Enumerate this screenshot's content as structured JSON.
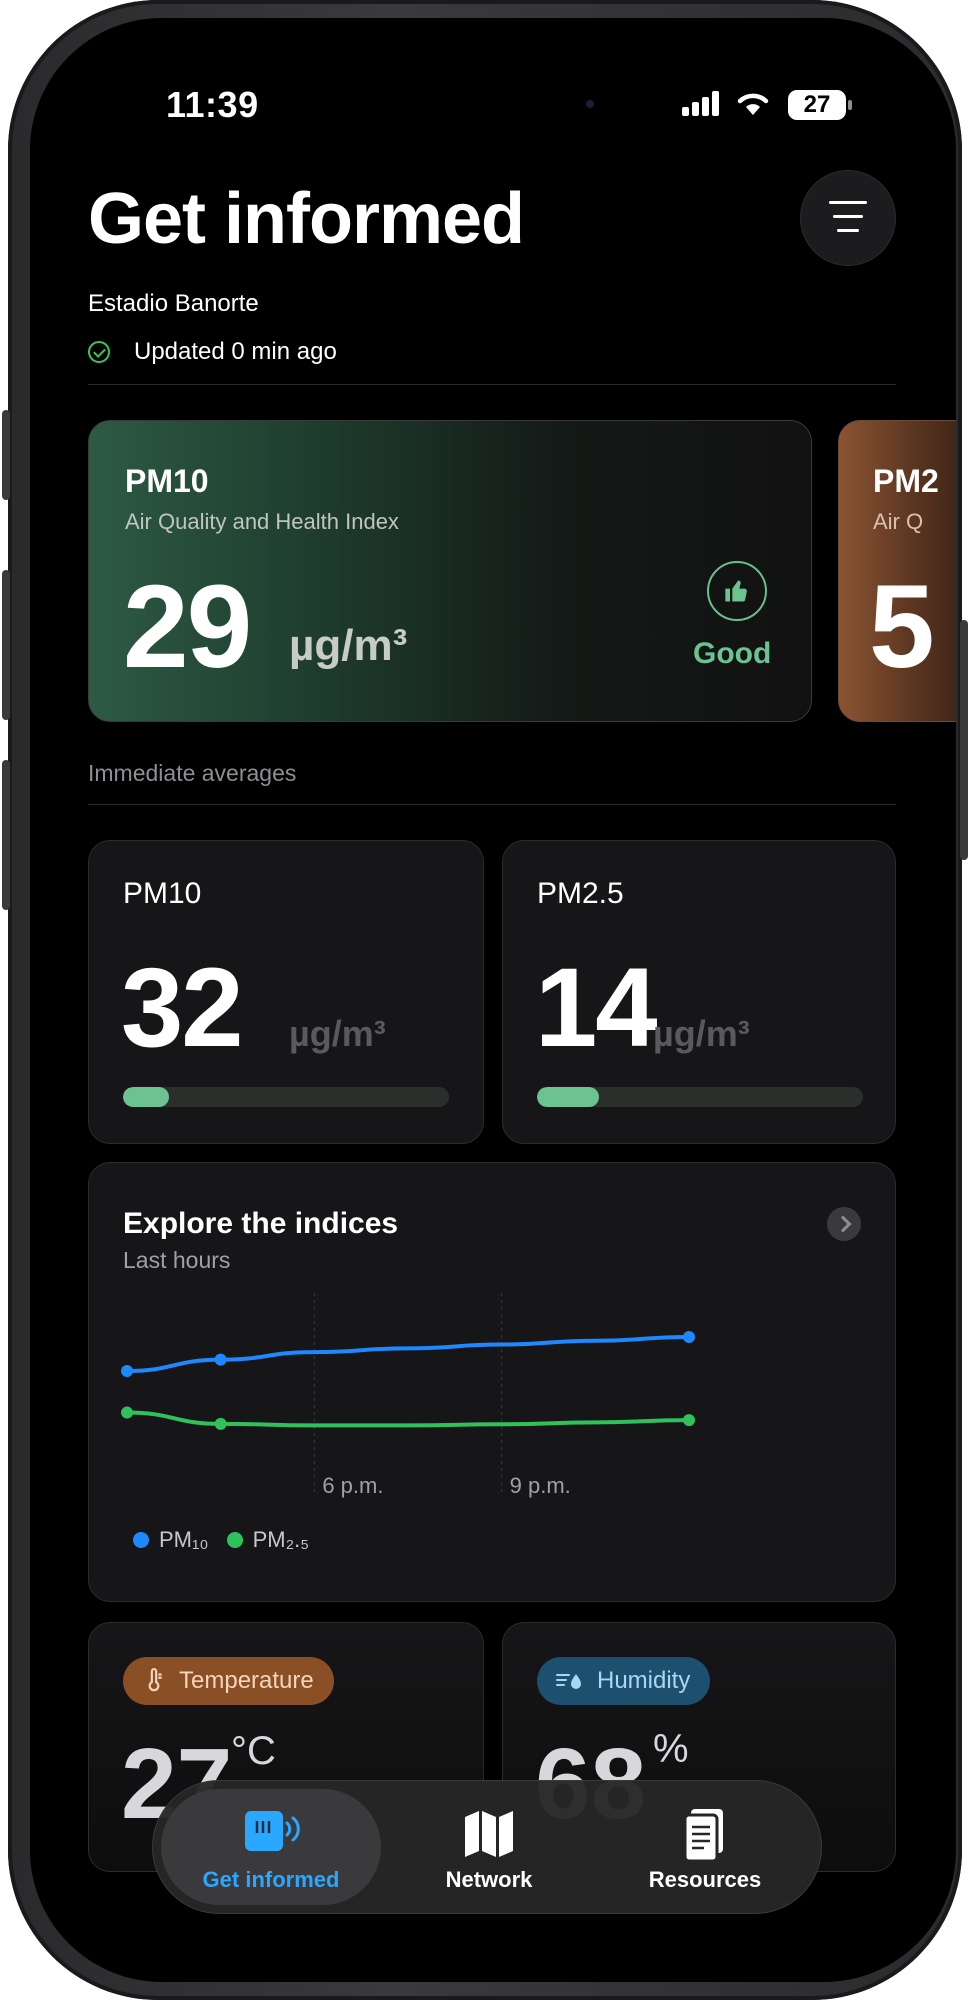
{
  "status": {
    "time": "11:39",
    "battery": "27"
  },
  "header": {
    "title": "Get informed",
    "location": "Estadio Banorte",
    "updated": "Updated 0 min ago"
  },
  "hero": {
    "title": "PM10",
    "subtitle": "Air Quality and Health Index",
    "value": "29",
    "unit": "µg/m³",
    "status": "Good",
    "status_color": "#6cc38f",
    "peek_title": "PM2",
    "peek_subtitle": "Air Q",
    "peek_value": "5"
  },
  "averages": {
    "label": "Immediate averages",
    "cards": [
      {
        "title": "PM10",
        "value": "32",
        "unit": "µg/m³",
        "fill": 0.14
      },
      {
        "title": "PM2.5",
        "value": "14",
        "unit": "µg/m³",
        "fill": 0.19
      }
    ]
  },
  "chart": {
    "title": "Explore the indices",
    "subtitle": "Last hours",
    "tick_6": "6 p.m.",
    "tick_9": "9 p.m.",
    "legend_pm10": "PM₁₀",
    "legend_pm25": "PM₂.₅"
  },
  "chart_data": {
    "type": "line",
    "title": "Explore the indices",
    "x": [
      0,
      1,
      2,
      3,
      4,
      5,
      6
    ],
    "x_tick_labels": {
      "6 p.m.": 2,
      "9 p.m.": 4
    },
    "series": [
      {
        "name": "PM₁₀",
        "color": "#1e88ff",
        "values": [
          [
            0,
            27
          ],
          [
            1,
            30
          ],
          [
            6,
            36
          ]
        ],
        "smooth": [
          [
            2,
            32
          ],
          [
            3,
            33
          ],
          [
            4,
            34
          ],
          [
            5,
            35
          ]
        ]
      },
      {
        "name": "PM₂.₅",
        "color": "#2fc25b",
        "values": [
          [
            0,
            16
          ],
          [
            1,
            13
          ],
          [
            6,
            14
          ]
        ],
        "smooth": [
          [
            2,
            12.6
          ],
          [
            3,
            12.6
          ],
          [
            4,
            12.9
          ],
          [
            5,
            13.4
          ]
        ]
      }
    ],
    "ylim": [
      0,
      45
    ],
    "grid": "vertical-dashed",
    "legend": "bottom-left"
  },
  "env": {
    "temperature": {
      "label": "Temperature",
      "value": "27",
      "unit": "°C",
      "color": "#8b4f25"
    },
    "humidity": {
      "label": "Humidity",
      "value": "68",
      "unit": "%",
      "color": "#1d4f6e"
    }
  },
  "tabs": [
    {
      "label": "Get informed",
      "icon": "sensor-icon",
      "active": true
    },
    {
      "label": "Network",
      "icon": "map-icon",
      "active": false
    },
    {
      "label": "Resources",
      "icon": "document-icon",
      "active": false
    }
  ]
}
